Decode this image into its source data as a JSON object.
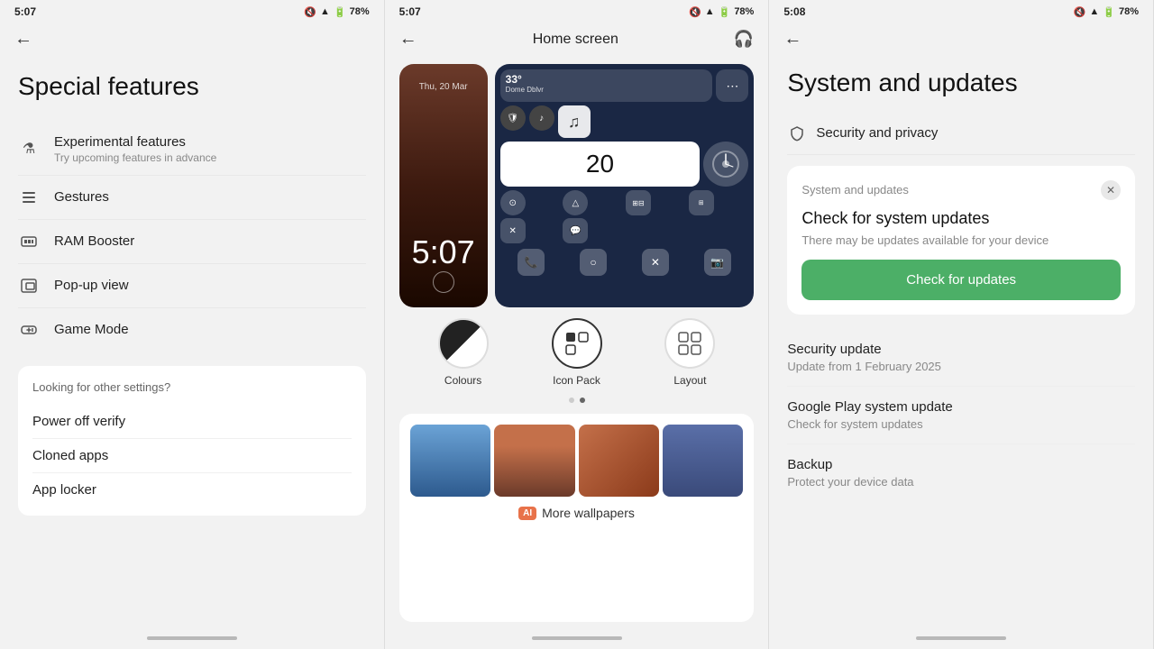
{
  "panel1": {
    "status": {
      "time": "5:07",
      "battery": "78%"
    },
    "title": "Special features",
    "menu_items": [
      {
        "id": "experimental",
        "icon": "⚗",
        "label": "Experimental features",
        "sublabel": "Try upcoming features in advance"
      },
      {
        "id": "gestures",
        "icon": "☰",
        "label": "Gestures",
        "sublabel": ""
      },
      {
        "id": "ram",
        "icon": "▣",
        "label": "RAM Booster",
        "sublabel": ""
      },
      {
        "id": "popup",
        "icon": "⊞",
        "label": "Pop-up view",
        "sublabel": ""
      },
      {
        "id": "game",
        "icon": "◎",
        "label": "Game Mode",
        "sublabel": ""
      }
    ],
    "suggestions_heading": "Looking for other settings?",
    "suggestions": [
      "Power off verify",
      "Cloned apps",
      "App locker"
    ]
  },
  "panel2": {
    "status": {
      "time": "5:07",
      "battery": "78%"
    },
    "title": "Home screen",
    "phone_dark_time": "5:07",
    "phone_dark_date": "Thu, 20 Mar",
    "phone_light_time": "20",
    "phone_light_temp": "33°",
    "style_options": [
      {
        "id": "colours",
        "label": "Colours"
      },
      {
        "id": "icon_pack",
        "label": "Icon Pack"
      },
      {
        "id": "layout",
        "label": "Layout"
      }
    ],
    "dots": [
      false,
      true
    ],
    "more_wallpapers_label": "More wallpapers",
    "ai_label": "AI"
  },
  "panel3": {
    "status": {
      "time": "5:08",
      "battery": "78%"
    },
    "title": "System and updates",
    "security_privacy": "Security and privacy",
    "updates_card": {
      "header": "System and updates",
      "check_title": "Check for system updates",
      "check_sub": "There may be updates available for your device",
      "check_btn": "Check for updates"
    },
    "update_items": [
      {
        "title": "Security update",
        "sub": "Update from 1 February 2025"
      },
      {
        "title": "Google Play system update",
        "sub": "Check for system updates"
      },
      {
        "title": "Backup",
        "sub": "Protect your device data"
      }
    ]
  }
}
